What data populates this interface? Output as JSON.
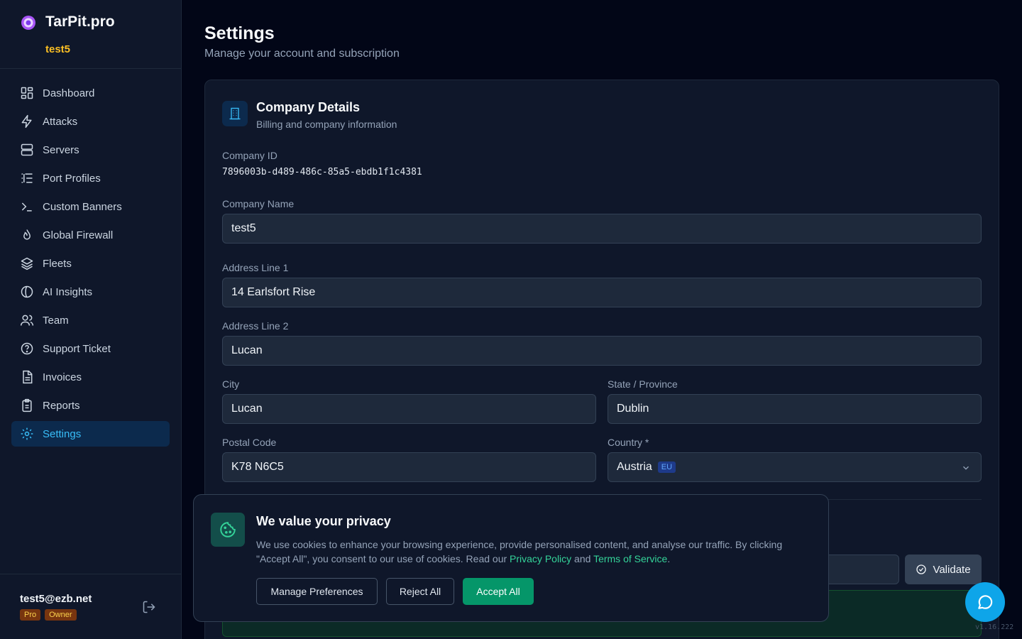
{
  "brand": {
    "name": "TarPit.pro",
    "org": "test5"
  },
  "nav": [
    {
      "label": "Dashboard",
      "icon": "dashboard-icon"
    },
    {
      "label": "Attacks",
      "icon": "lightning-icon"
    },
    {
      "label": "Servers",
      "icon": "server-icon"
    },
    {
      "label": "Port Profiles",
      "icon": "list-icon"
    },
    {
      "label": "Custom Banners",
      "icon": "terminal-icon"
    },
    {
      "label": "Global Firewall",
      "icon": "flame-icon"
    },
    {
      "label": "Fleets",
      "icon": "layers-icon"
    },
    {
      "label": "AI Insights",
      "icon": "brain-icon"
    },
    {
      "label": "Team",
      "icon": "users-icon"
    },
    {
      "label": "Support Ticket",
      "icon": "help-circle-icon"
    },
    {
      "label": "Invoices",
      "icon": "file-text-icon"
    },
    {
      "label": "Reports",
      "icon": "clipboard-icon"
    },
    {
      "label": "Settings",
      "icon": "gear-icon",
      "active": true
    }
  ],
  "user": {
    "email": "test5@ezb.net",
    "plan_badge": "Pro",
    "role_badge": "Owner"
  },
  "page": {
    "title": "Settings",
    "subtitle": "Manage your account and subscription"
  },
  "company": {
    "title": "Company Details",
    "subtitle": "Billing and company information",
    "id_label": "Company ID",
    "id_value": "7896003b-d489-486c-85a5-ebdb1f1c4381",
    "name_label": "Company Name",
    "name_value": "test5",
    "address1_label": "Address Line 1",
    "address1_value": "14 Earlsfort Rise",
    "address2_label": "Address Line 2",
    "address2_value": "Lucan",
    "city_label": "City",
    "city_value": "Lucan",
    "state_label": "State / Province",
    "state_value": "Dublin",
    "postal_label": "Postal Code",
    "postal_value": "K78 N6C5",
    "country_label": "Country *",
    "country_value": "Austria",
    "country_tag": "EU",
    "validate_label": "Validate"
  },
  "cookie": {
    "title": "We value your privacy",
    "body_before": "We use cookies to enhance your browsing experience, provide personalised content, and analyse our traffic. By clicking \"Accept All\", you consent to our use of cookies. Read our ",
    "privacy_link": "Privacy Policy",
    "and_text": " and ",
    "terms_link": "Terms of Service",
    "body_after": ".",
    "manage_label": "Manage Preferences",
    "reject_label": "Reject All",
    "accept_label": "Accept All"
  },
  "version": "v1.16.222",
  "colors": {
    "accent": "#38bdf8",
    "brand_org": "#fbbf24",
    "accept": "#059669",
    "chat": "#0ea5e9"
  }
}
